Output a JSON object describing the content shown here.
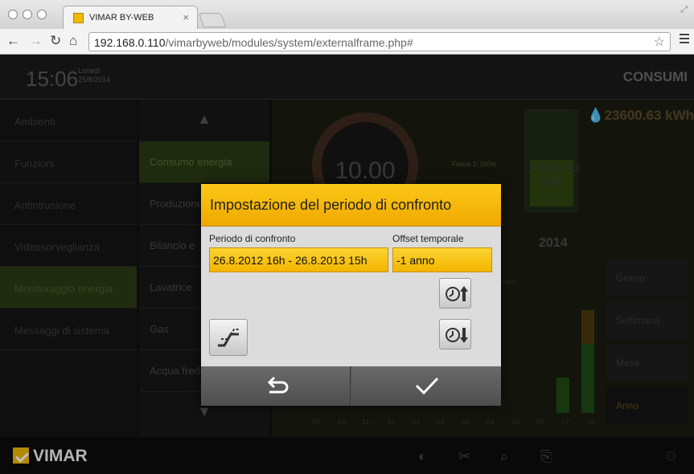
{
  "browser": {
    "tab_title": "VIMAR BY-WEB",
    "tab_close": "×",
    "url_host": "192.168.0.110",
    "url_path": "/vimarbyweb/modules/system/externalframe.php#"
  },
  "app": {
    "time": "15:06",
    "day": "Lunedì",
    "date": "25/8/2014",
    "section_title": "CONSUMI",
    "sidebar": [
      {
        "label": "Ambienti"
      },
      {
        "label": "Funzioni"
      },
      {
        "label": "Antintrusione"
      },
      {
        "label": "Videosorveglianza"
      },
      {
        "label": "Monitoraggio energia"
      },
      {
        "label": "Messaggi di sistema"
      }
    ],
    "submenu": [
      {
        "label": "Consumo energia"
      },
      {
        "label": "Produzione"
      },
      {
        "label": "Bilancio e"
      },
      {
        "label": "Lavatrice"
      },
      {
        "label": "Gas"
      },
      {
        "label": "Acqua fredda"
      }
    ],
    "gauge_value": "10.00",
    "fascia": "Fascia 1: 100%",
    "battery_value": "15300.00",
    "battery_unit": "kWh",
    "total": "23600.63 kWh",
    "year": "2014",
    "chart_label": "onato",
    "months": [
      "09",
      "10",
      "11",
      "12",
      "01",
      "02",
      "03",
      "04",
      "05",
      "06",
      "07",
      "08"
    ],
    "period_buttons": [
      {
        "label": "Giorno"
      },
      {
        "label": "Settimana"
      },
      {
        "label": "Mese"
      },
      {
        "label": "Anno"
      }
    ],
    "footer_logo": "VIMAR"
  },
  "dialog": {
    "title": "Impostazione del periodo di confronto",
    "period_label": "Periodo di confronto",
    "period_value": "26.8.2012 16h - 26.8.2013 15h",
    "offset_label": "Offset temporale",
    "offset_value": "-1 anno"
  },
  "colors": {
    "accent": "#f4b500",
    "dialog_bg": "#dcdcdc"
  }
}
